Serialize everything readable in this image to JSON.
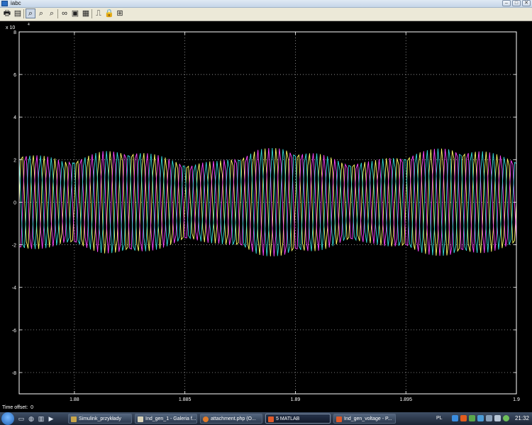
{
  "window": {
    "title": "iabc"
  },
  "window_buttons": {
    "minimize": "–",
    "maximize": "□",
    "close": "✕"
  },
  "toolbar": {
    "icons": [
      "print-icon",
      "params-icon",
      "zoom-icon",
      "zoom-x-icon",
      "zoom-y-icon",
      "binoculars-icon",
      "save-axes-icon",
      "restore-axes-icon",
      "floating-scope-icon",
      "lock-icon",
      "signal-selection-icon"
    ],
    "glyphs": {
      "print": "🖶",
      "params": "▤",
      "zoom": "⌕",
      "zoom_x": "⌕",
      "zoom_y": "⌕",
      "binoculars": "∞",
      "save_axes": "▣",
      "restore_axes": "▦",
      "floating": "⎍",
      "lock": "🔒",
      "select": "⊞"
    }
  },
  "plot": {
    "background": "#000000",
    "axes_color": "#ffffff",
    "exponent_label": "x 10",
    "exponent_power": "4"
  },
  "chart_data": {
    "type": "line",
    "xlim": [
      1.8775,
      1.9
    ],
    "ylim": [
      -90000,
      80000
    ],
    "xticks": [
      1.88,
      1.885,
      1.89,
      1.895,
      1.9
    ],
    "xtick_labels": [
      "1.88",
      "1.885",
      "1.89",
      "1.895",
      "1.9"
    ],
    "yticks": [
      -80000,
      -60000,
      -40000,
      -20000,
      0,
      20000,
      40000,
      60000,
      80000
    ],
    "ytick_labels": [
      "-8",
      "-6",
      "-4",
      "-2",
      "0",
      "2",
      "4",
      "6",
      "8"
    ],
    "grid": true,
    "x_start": 1.8775,
    "x_end": 1.9,
    "signal_frequency_hz": 2000,
    "base_amplitude": 20000,
    "envelope_peaks": [
      {
        "x": 1.8775,
        "amplitude": 24000
      },
      {
        "x": 1.8795,
        "amplitude": 20000
      },
      {
        "x": 1.8813,
        "amplitude": 24000
      },
      {
        "x": 1.8827,
        "amplitude": 25000
      },
      {
        "x": 1.8842,
        "amplitude": 21000
      },
      {
        "x": 1.8853,
        "amplitude": 18500
      },
      {
        "x": 1.8865,
        "amplitude": 19500
      },
      {
        "x": 1.8883,
        "amplitude": 25000
      },
      {
        "x": 1.8895,
        "amplitude": 26000
      },
      {
        "x": 1.891,
        "amplitude": 23000
      },
      {
        "x": 1.8922,
        "amplitude": 19500
      },
      {
        "x": 1.8935,
        "amplitude": 19500
      },
      {
        "x": 1.8955,
        "amplitude": 24000
      },
      {
        "x": 1.897,
        "amplitude": 26000
      },
      {
        "x": 1.8985,
        "amplitude": 24000
      },
      {
        "x": 1.9,
        "amplitude": 21000
      }
    ],
    "series": [
      {
        "color": "#ffff66",
        "phase_deg": 0
      },
      {
        "color": "#ff44ff",
        "phase_deg": -120
      },
      {
        "color": "#33dddd",
        "phase_deg": 120
      }
    ]
  },
  "status": {
    "time_offset_label": "Time offset:",
    "time_offset_value": "0"
  },
  "taskbar": {
    "tasks": [
      {
        "label": "Simulink_przykłady"
      },
      {
        "label": "Ind_gen_1 - Galeria f..."
      },
      {
        "label": "attachment.php (O..."
      },
      {
        "label": "5 MATLAB"
      },
      {
        "label": "Ind_gen_voltage - P..."
      }
    ],
    "language": "PL",
    "clock": "21:32"
  }
}
